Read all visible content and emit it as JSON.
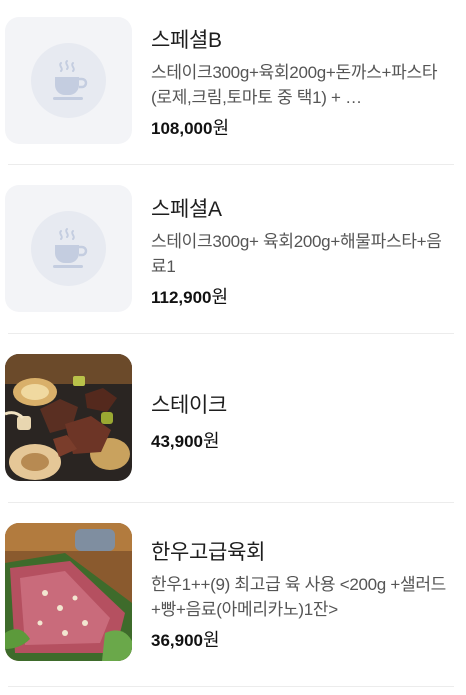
{
  "menu": {
    "items": [
      {
        "name": "스페셜B",
        "description": "스테이크300g+육회200g+돈까스+파스타(로제,크림,토마토 중 택1) + …",
        "price": "108,000",
        "currency": "원",
        "image": "placeholder-cup-icon"
      },
      {
        "name": "스페셜A",
        "description": "스테이크300g+ 육회200g+해물파스타+음료1",
        "price": "112,900",
        "currency": "원",
        "image": "placeholder-cup-icon"
      },
      {
        "name": "스테이크",
        "description": "",
        "price": "43,900",
        "currency": "원",
        "image": "steak-photo"
      },
      {
        "name": "한우고급육회",
        "description": "한우1++(9) 최고급 육 사용 <200g +샐러드+빵+음료(아메리카노)1잔>",
        "price": "36,900",
        "currency": "원",
        "image": "yukhoe-photo"
      }
    ]
  },
  "colors": {
    "placeholder_bg": "#f3f4f7",
    "placeholder_circle": "#e7eaf1",
    "icon": "#c4cde0",
    "divider": "#ececec"
  }
}
